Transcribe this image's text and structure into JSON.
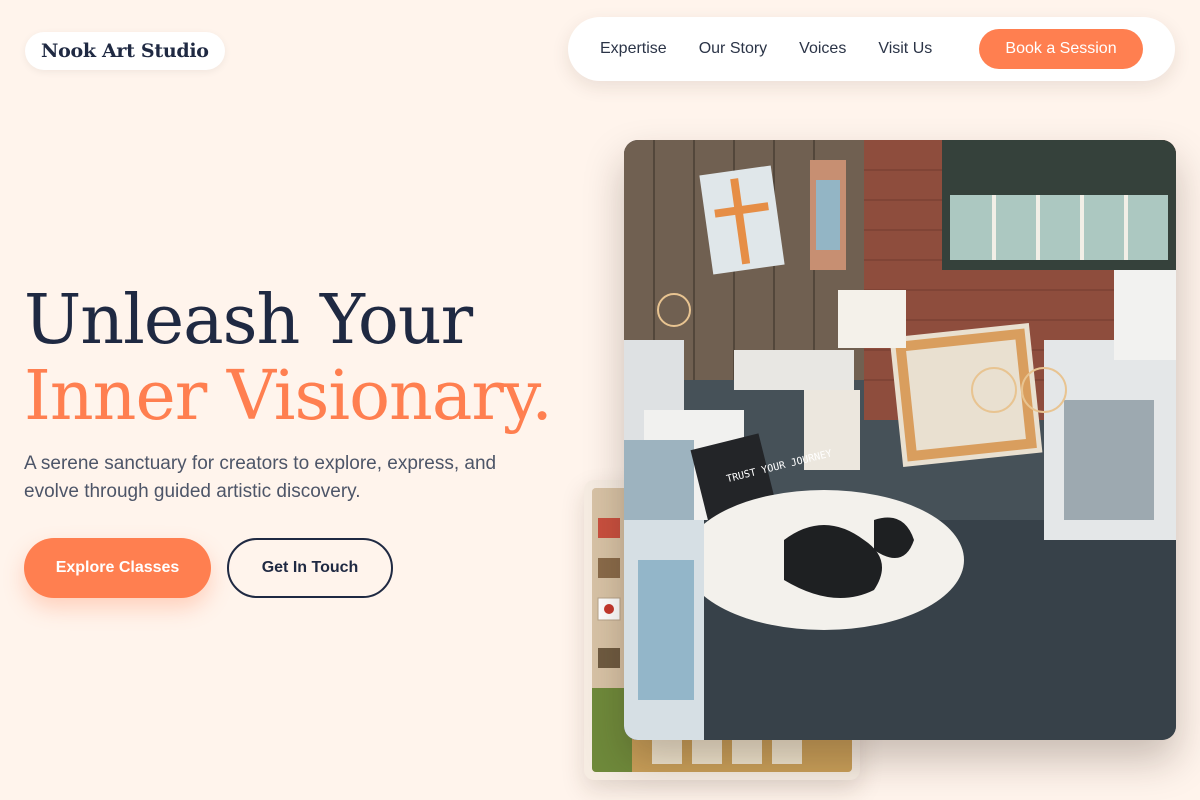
{
  "brand": {
    "name": "Nook Art Studio"
  },
  "nav": {
    "links": [
      "Expertise",
      "Our Story",
      "Voices",
      "Visit Us"
    ],
    "cta": "Book a Session"
  },
  "hero": {
    "line1": "Unleash Your",
    "line2": "Inner Visionary.",
    "subtitle": "A serene sanctuary for creators to explore, express, and evolve through guided artistic discovery.",
    "primary_button": "Explore Classes",
    "secondary_button": "Get In Touch"
  },
  "photo_main": {
    "sign_text": "TRUST YOUR JOURNEY"
  },
  "colors": {
    "background": "#fff4ec",
    "accent": "#ff7f50",
    "navy": "#1f2942"
  }
}
